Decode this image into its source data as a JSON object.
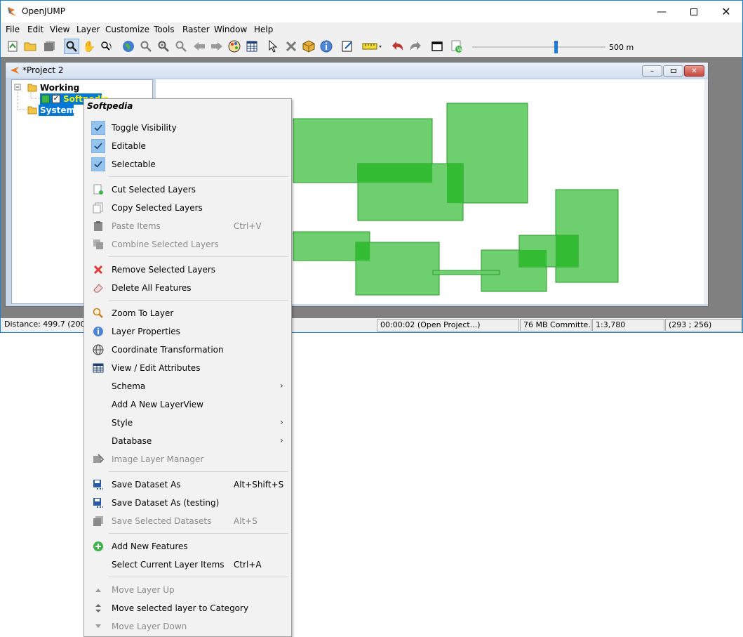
{
  "window": {
    "title": "OpenJUMP"
  },
  "menubar": [
    "File",
    "Edit",
    "View",
    "Layer",
    "Customize",
    "Tools",
    "Raster",
    "Window",
    "Help"
  ],
  "toolbar": {
    "scale_label": "500 m",
    "slider_fraction": 0.62
  },
  "project": {
    "title": "*Project 2"
  },
  "tree": {
    "category_working": "Working",
    "layer_softpedia": "Softpedia",
    "category_system": "System"
  },
  "statusbar": {
    "distance": "Distance: 499.7 (200)",
    "time": "00:00:02 (Open Project...)",
    "memory": "76 MB Committe...",
    "scale": "1:3,780",
    "coords": "(293 ; 256)"
  },
  "context_menu": {
    "title": "Softpedia",
    "items": [
      {
        "label": "Toggle Visibility",
        "shortcut": "",
        "checked": true,
        "enabled": true,
        "icon": "check-icon"
      },
      {
        "label": "Editable",
        "shortcut": "",
        "checked": true,
        "enabled": true,
        "icon": "check-icon"
      },
      {
        "label": "Selectable",
        "shortcut": "",
        "checked": true,
        "enabled": true,
        "icon": "check-icon"
      },
      {
        "label": "Cut Selected Layers",
        "shortcut": "",
        "enabled": true,
        "icon": "cut-icon"
      },
      {
        "label": "Copy Selected Layers",
        "shortcut": "",
        "enabled": true,
        "icon": "copy-icon"
      },
      {
        "label": "Paste Items",
        "shortcut": "Ctrl+V",
        "enabled": false,
        "icon": "paste-icon"
      },
      {
        "label": "Combine Selected Layers",
        "shortcut": "",
        "enabled": false,
        "icon": "combine-icon"
      },
      {
        "label": "Remove Selected Layers",
        "shortcut": "",
        "enabled": true,
        "icon": "remove-icon"
      },
      {
        "label": "Delete All Features",
        "shortcut": "",
        "enabled": true,
        "icon": "eraser-icon"
      },
      {
        "label": "Zoom To Layer",
        "shortcut": "",
        "enabled": true,
        "icon": "zoom-icon"
      },
      {
        "label": "Layer Properties",
        "shortcut": "",
        "enabled": true,
        "icon": "info-icon"
      },
      {
        "label": "Coordinate Transformation",
        "shortcut": "",
        "enabled": true,
        "icon": "globe-icon"
      },
      {
        "label": "View / Edit Attributes",
        "shortcut": "",
        "enabled": true,
        "icon": "table-icon"
      },
      {
        "label": "Schema",
        "shortcut": "",
        "enabled": true,
        "submenu": true
      },
      {
        "label": "Add A New LayerView",
        "shortcut": "",
        "enabled": true
      },
      {
        "label": "Style",
        "shortcut": "",
        "enabled": true,
        "submenu": true
      },
      {
        "label": "Database",
        "shortcut": "",
        "enabled": true,
        "submenu": true
      },
      {
        "label": "Image Layer Manager",
        "shortcut": "",
        "enabled": false,
        "icon": "image-layer-icon"
      },
      {
        "label": "Save Dataset As",
        "shortcut": "Alt+Shift+S",
        "enabled": true,
        "icon": "save-icon"
      },
      {
        "label": "Save Dataset As (testing)",
        "shortcut": "",
        "enabled": true,
        "icon": "save-icon"
      },
      {
        "label": "Save Selected Datasets",
        "shortcut": "Alt+S",
        "enabled": false,
        "icon": "save-multi-icon"
      },
      {
        "label": "Add New Features",
        "shortcut": "",
        "enabled": true,
        "icon": "add-icon"
      },
      {
        "label": "Select Current Layer Items",
        "shortcut": "Ctrl+A",
        "enabled": true
      },
      {
        "label": "Move Layer Up",
        "shortcut": "",
        "enabled": false,
        "icon": "arrow-up-icon"
      },
      {
        "label": "Move selected layer to Category",
        "shortcut": "",
        "enabled": true,
        "icon": "move-category-icon"
      },
      {
        "label": "Move Layer Down",
        "shortcut": "",
        "enabled": false,
        "icon": "arrow-down-icon"
      }
    ]
  },
  "colors": {
    "feature_fill": "#66cc66",
    "feature_overlap": "#33bb33",
    "feature_stroke": "#2a9a2a",
    "selection": "#0078d7",
    "check_bg": "#93c4ee",
    "remove_red": "#e03a3a",
    "add_green": "#3cb44a"
  }
}
